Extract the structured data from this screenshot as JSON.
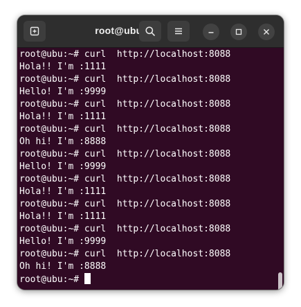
{
  "window": {
    "title": "root@ubu: ~",
    "icons": {
      "new_tab": "new-tab-icon",
      "search": "search-icon",
      "menu": "hamburger-menu-icon",
      "minimize": "minimize-icon",
      "maximize": "maximize-icon",
      "close": "close-icon"
    }
  },
  "terminal": {
    "background": "#300a24",
    "foreground": "#ffffff",
    "lines": [
      "root@ubu:~# curl  http://localhost:8088",
      "Hola!! I'm :1111",
      "root@ubu:~# curl  http://localhost:8088",
      "Hello! I'm :9999",
      "root@ubu:~# curl  http://localhost:8088",
      "Hola!! I'm :1111",
      "root@ubu:~# curl  http://localhost:8088",
      "Oh hi! I'm :8888",
      "root@ubu:~# curl  http://localhost:8088",
      "Hello! I'm :9999",
      "root@ubu:~# curl  http://localhost:8088",
      "Hola!! I'm :1111",
      "root@ubu:~# curl  http://localhost:8088",
      "Hola!! I'm :1111",
      "root@ubu:~# curl  http://localhost:8088",
      "Hello! I'm :9999",
      "root@ubu:~# curl  http://localhost:8088",
      "Oh hi! I'm :8888"
    ],
    "prompt": "root@ubu:~# "
  }
}
